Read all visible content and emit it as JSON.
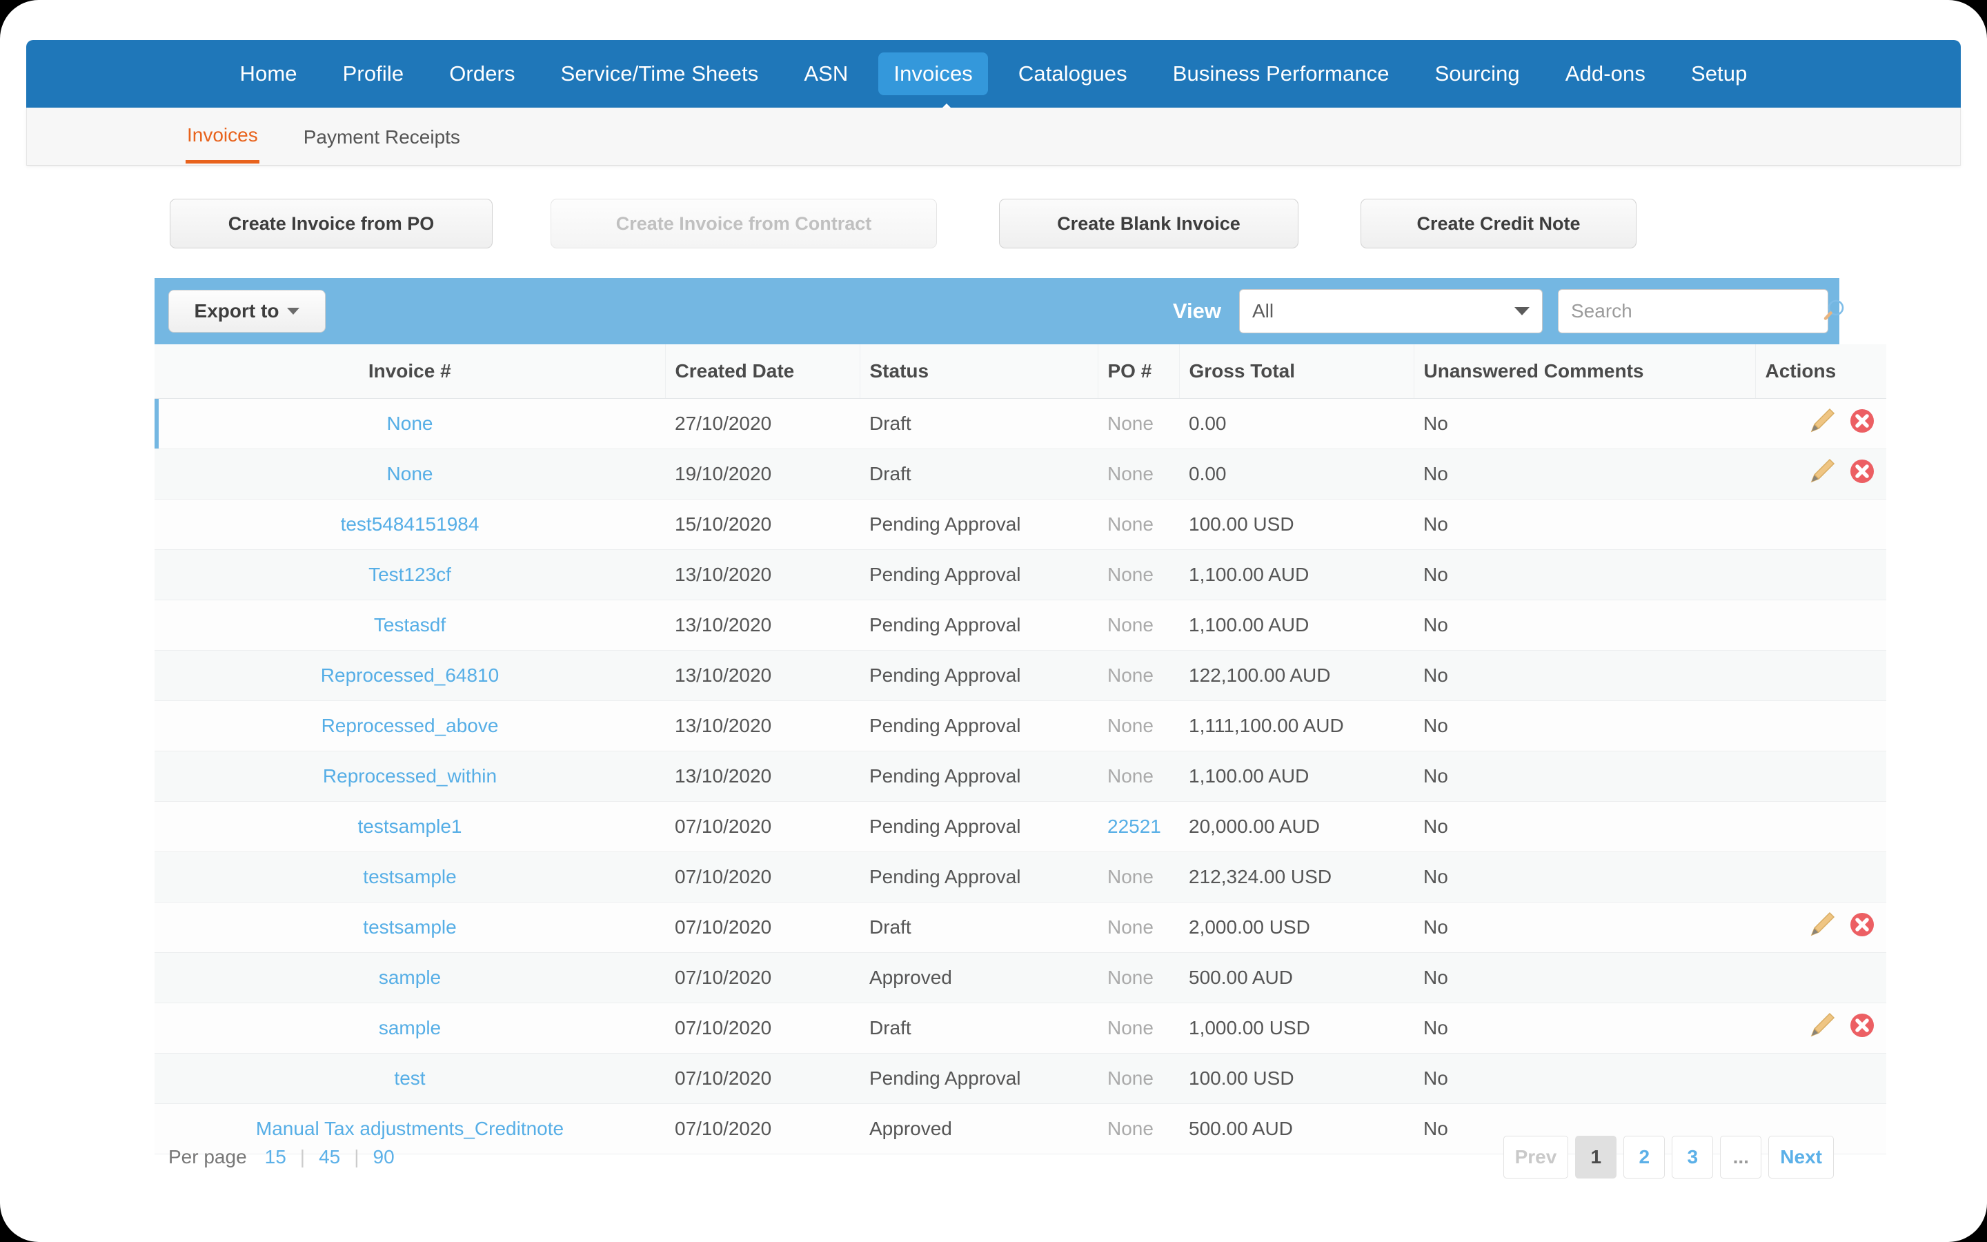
{
  "nav": {
    "items": [
      {
        "label": "Home",
        "active": false
      },
      {
        "label": "Profile",
        "active": false
      },
      {
        "label": "Orders",
        "active": false
      },
      {
        "label": "Service/Time Sheets",
        "active": false
      },
      {
        "label": "ASN",
        "active": false
      },
      {
        "label": "Invoices",
        "active": true
      },
      {
        "label": "Catalogues",
        "active": false
      },
      {
        "label": "Business Performance",
        "active": false
      },
      {
        "label": "Sourcing",
        "active": false
      },
      {
        "label": "Add-ons",
        "active": false
      },
      {
        "label": "Setup",
        "active": false
      }
    ],
    "bg_color": "#1f77b9",
    "active_color": "#3498db"
  },
  "subnav": {
    "items": [
      {
        "label": "Invoices",
        "active": true
      },
      {
        "label": "Payment Receipts",
        "active": false
      }
    ],
    "active_color": "#e8621c"
  },
  "actions": {
    "create_from_po": "Create Invoice from PO",
    "create_from_contract": "Create Invoice from Contract",
    "create_blank": "Create Blank Invoice",
    "create_credit_note": "Create Credit Note"
  },
  "toolbar": {
    "export_label": "Export to",
    "view_label": "View",
    "view_value": "All",
    "search_placeholder": "Search",
    "search_value": "",
    "bg_color": "#74b7e2"
  },
  "table": {
    "columns": [
      "Invoice #",
      "Created Date",
      "Status",
      "PO #",
      "Gross Total",
      "Unanswered Comments",
      "Actions"
    ],
    "rows": [
      {
        "invoice": "None",
        "date": "27/10/2020",
        "status": "Draft",
        "po": "None",
        "po_link": false,
        "gross": "0.00",
        "comments": "No",
        "actions": true
      },
      {
        "invoice": "None",
        "date": "19/10/2020",
        "status": "Draft",
        "po": "None",
        "po_link": false,
        "gross": "0.00",
        "comments": "No",
        "actions": true
      },
      {
        "invoice": "test5484151984",
        "date": "15/10/2020",
        "status": "Pending Approval",
        "po": "None",
        "po_link": false,
        "gross": "100.00 USD",
        "comments": "No",
        "actions": false
      },
      {
        "invoice": "Test123cf",
        "date": "13/10/2020",
        "status": "Pending Approval",
        "po": "None",
        "po_link": false,
        "gross": "1,100.00 AUD",
        "comments": "No",
        "actions": false
      },
      {
        "invoice": "Testasdf",
        "date": "13/10/2020",
        "status": "Pending Approval",
        "po": "None",
        "po_link": false,
        "gross": "1,100.00 AUD",
        "comments": "No",
        "actions": false
      },
      {
        "invoice": "Reprocessed_64810",
        "date": "13/10/2020",
        "status": "Pending Approval",
        "po": "None",
        "po_link": false,
        "gross": "122,100.00 AUD",
        "comments": "No",
        "actions": false
      },
      {
        "invoice": "Reprocessed_above",
        "date": "13/10/2020",
        "status": "Pending Approval",
        "po": "None",
        "po_link": false,
        "gross": "1,111,100.00 AUD",
        "comments": "No",
        "actions": false
      },
      {
        "invoice": "Reprocessed_within",
        "date": "13/10/2020",
        "status": "Pending Approval",
        "po": "None",
        "po_link": false,
        "gross": "1,100.00 AUD",
        "comments": "No",
        "actions": false
      },
      {
        "invoice": "testsample1",
        "date": "07/10/2020",
        "status": "Pending Approval",
        "po": "22521",
        "po_link": true,
        "gross": "20,000.00 AUD",
        "comments": "No",
        "actions": false
      },
      {
        "invoice": "testsample",
        "date": "07/10/2020",
        "status": "Pending Approval",
        "po": "None",
        "po_link": false,
        "gross": "212,324.00 USD",
        "comments": "No",
        "actions": false
      },
      {
        "invoice": "testsample",
        "date": "07/10/2020",
        "status": "Draft",
        "po": "None",
        "po_link": false,
        "gross": "2,000.00 USD",
        "comments": "No",
        "actions": true
      },
      {
        "invoice": "sample",
        "date": "07/10/2020",
        "status": "Approved",
        "po": "None",
        "po_link": false,
        "gross": "500.00 AUD",
        "comments": "No",
        "actions": false
      },
      {
        "invoice": "sample",
        "date": "07/10/2020",
        "status": "Draft",
        "po": "None",
        "po_link": false,
        "gross": "1,000.00 USD",
        "comments": "No",
        "actions": true
      },
      {
        "invoice": "test",
        "date": "07/10/2020",
        "status": "Pending Approval",
        "po": "None",
        "po_link": false,
        "gross": "100.00 USD",
        "comments": "No",
        "actions": false
      },
      {
        "invoice": "Manual Tax adjustments_Creditnote",
        "date": "07/10/2020",
        "status": "Approved",
        "po": "None",
        "po_link": false,
        "gross": "500.00 AUD",
        "comments": "No",
        "actions": false
      }
    ],
    "link_color": "#56aee6",
    "row_accent_color": "#74b7e2"
  },
  "footer": {
    "per_page_label": "Per page",
    "per_page_options": [
      "15",
      "45",
      "90"
    ],
    "pager": {
      "prev": "Prev",
      "pages": [
        "1",
        "2",
        "3"
      ],
      "ellipsis": "...",
      "next": "Next",
      "current": "1"
    }
  },
  "icons": {
    "edit": "pencil-icon",
    "delete": "delete-icon",
    "search": "search-icon"
  }
}
